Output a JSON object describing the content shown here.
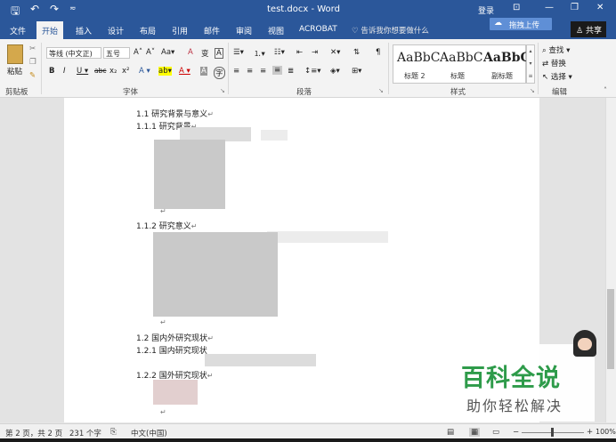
{
  "titlebar": {
    "title": "test.docx - Word",
    "login": "登录"
  },
  "tabs": [
    {
      "label": "文件"
    },
    {
      "label": "开始"
    },
    {
      "label": "插入"
    },
    {
      "label": "设计"
    },
    {
      "label": "布局"
    },
    {
      "label": "引用"
    },
    {
      "label": "邮件"
    },
    {
      "label": "审阅"
    },
    {
      "label": "视图"
    },
    {
      "label": "ACROBAT"
    }
  ],
  "tell_me": "告诉我你想要做什么",
  "upload_label": "拖拽上传",
  "share_label": "共享",
  "ribbon": {
    "clipboard": {
      "paste": "粘贴",
      "group": "剪贴板"
    },
    "font": {
      "name": "等线 (中文正)",
      "size": "五号",
      "group": "字体"
    },
    "paragraph": {
      "group": "段落"
    },
    "styles": {
      "items": [
        {
          "sample": "AaBbC",
          "label": "标题 2"
        },
        {
          "sample": "AaBbC",
          "label": "标题"
        },
        {
          "sample": "AaBbC",
          "label": "副标题"
        }
      ],
      "group": "样式"
    },
    "editing": {
      "find": "查找",
      "replace": "替换",
      "select": "选择",
      "group": "编辑"
    }
  },
  "document": {
    "lines": [
      {
        "text": "1.1 研究背景与意义"
      },
      {
        "text": "1.1.1 研究背景"
      },
      {
        "text": "1.1.2 研究意义"
      },
      {
        "text": "1.2 国内外研究现状"
      },
      {
        "text": "1.2.1 国内研究现状"
      },
      {
        "text": "1.2.2 国外研究现状"
      }
    ],
    "para_mark": "↵"
  },
  "status": {
    "page": "第 2 页，共 2 页",
    "words": "231 个字",
    "language": "中文(中国)",
    "zoom": "100%"
  },
  "watermark": {
    "main": "百科全说",
    "sub": "助你轻松解决"
  },
  "colors": {
    "accent": "#2b579a",
    "watermark_green": "#2e9b4a"
  }
}
